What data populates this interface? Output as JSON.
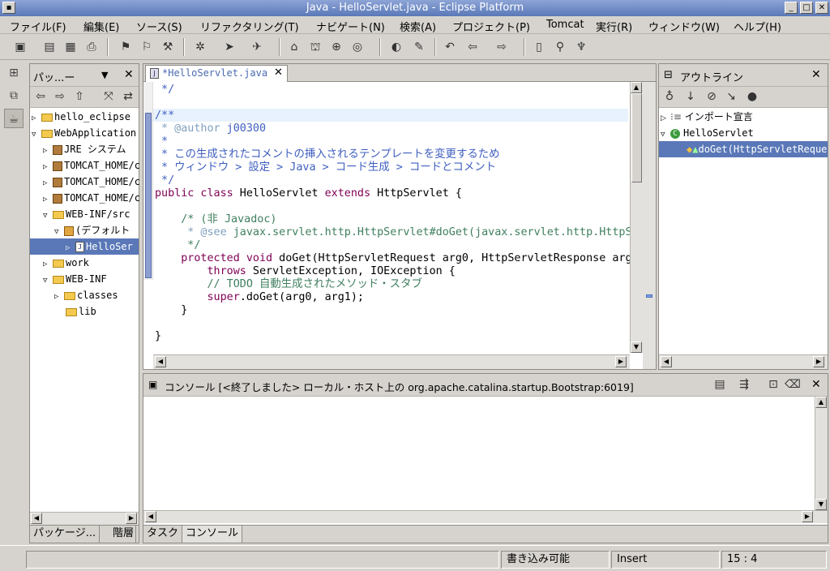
{
  "window": {
    "title": "Java - HelloServlet.java - Eclipse Platform"
  },
  "menu": [
    "ファイル(F)",
    "編集(E)",
    "ソース(S)",
    "リファクタリング(T)",
    "ナビゲート(N)",
    "検索(A)",
    "プロジェクト(P)",
    "Tomcat",
    "実行(R)",
    "ウィンドウ(W)",
    "ヘルプ(H)"
  ],
  "package_explorer": {
    "title": "パッ...ー",
    "items": [
      "hello_eclipse",
      "WebApplication",
      "JRE システム",
      "TOMCAT_HOME/c",
      "TOMCAT_HOME/c",
      "TOMCAT_HOME/c",
      "WEB-INF/src",
      "(デフォルト",
      "HelloSer",
      "work",
      "WEB-INF",
      "classes",
      "lib"
    ],
    "tabs": [
      "パッケージ...",
      "階層"
    ]
  },
  "editor": {
    "tab": "*HelloServlet.java",
    "lines": {
      "l0": " */",
      "l1": "/**",
      "l2": " * @author",
      "l2b": " j00300",
      "l3": " *",
      "l4": " * この生成されたコメントの挿入されるテンプレートを変更するため",
      "l5": " * ウィンドウ > 設定 > Java > コード生成 > コードとコメント",
      "l6": " */",
      "l7a": "public class",
      "l7b": " HelloServlet ",
      "l7c": "extends",
      "l7d": " HttpServlet {",
      "l8": "    /* (非 Javadoc)",
      "l9a": "     * @see",
      "l9b": " javax.servlet.http.HttpServlet#doGet(javax.servlet.http.HttpS",
      "l10": "     */",
      "l11a": "    protected void",
      "l11b": " doGet(HttpServletRequest arg0, HttpServletResponse arg",
      "l12a": "        throws",
      "l12b": " ServletException, IOException {",
      "l13": "        // TODO 自動生成されたメソッド・スタブ",
      "l14a": "        super",
      "l14b": ".doGet(arg0, arg1);",
      "l15": "    }",
      "l16": "}"
    }
  },
  "outline": {
    "title": "アウトライン",
    "items": [
      "インポート宣言",
      "HelloServlet",
      "doGet(HttpServletReque"
    ]
  },
  "console": {
    "title": "コンソール [<終了しました> ローカル・ホスト上の org.apache.catalina.startup.Bootstrap:6019]",
    "tabs": [
      "タスク",
      "コンソール"
    ]
  },
  "status": {
    "writable": "書き込み可能",
    "mode": "Insert",
    "position": "15 : 4"
  }
}
